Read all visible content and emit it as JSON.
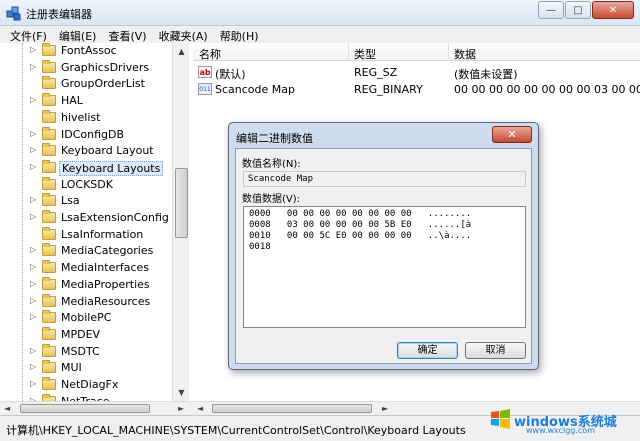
{
  "window": {
    "title": "注册表编辑器",
    "minimize_glyph": "—",
    "maximize_glyph": "□",
    "close_glyph": "✕"
  },
  "menu": [
    "文件(F)",
    "编辑(E)",
    "查看(V)",
    "收藏夹(A)",
    "帮助(H)"
  ],
  "tree": {
    "items": [
      {
        "label": "FontAssoc",
        "expandable": true,
        "selected": false
      },
      {
        "label": "GraphicsDrivers",
        "expandable": true,
        "selected": false
      },
      {
        "label": "GroupOrderList",
        "expandable": false,
        "selected": false
      },
      {
        "label": "HAL",
        "expandable": true,
        "selected": false
      },
      {
        "label": "hivelist",
        "expandable": false,
        "selected": false
      },
      {
        "label": "IDConfigDB",
        "expandable": true,
        "selected": false
      },
      {
        "label": "Keyboard Layout",
        "expandable": true,
        "selected": false
      },
      {
        "label": "Keyboard Layouts",
        "expandable": true,
        "selected": true
      },
      {
        "label": "LOCKSDK",
        "expandable": false,
        "selected": false
      },
      {
        "label": "Lsa",
        "expandable": true,
        "selected": false
      },
      {
        "label": "LsaExtensionConfig",
        "expandable": true,
        "selected": false
      },
      {
        "label": "LsaInformation",
        "expandable": false,
        "selected": false
      },
      {
        "label": "MediaCategories",
        "expandable": true,
        "selected": false
      },
      {
        "label": "MediaInterfaces",
        "expandable": true,
        "selected": false
      },
      {
        "label": "MediaProperties",
        "expandable": true,
        "selected": false
      },
      {
        "label": "MediaResources",
        "expandable": true,
        "selected": false
      },
      {
        "label": "MobilePC",
        "expandable": true,
        "selected": false
      },
      {
        "label": "MPDEV",
        "expandable": false,
        "selected": false
      },
      {
        "label": "MSDTC",
        "expandable": true,
        "selected": false
      },
      {
        "label": "MUI",
        "expandable": true,
        "selected": false
      },
      {
        "label": "NetDiagFx",
        "expandable": true,
        "selected": false
      },
      {
        "label": "NetTrace",
        "expandable": true,
        "selected": false
      }
    ]
  },
  "values_pane": {
    "headers": {
      "name": "名称",
      "type": "类型",
      "data": "数据"
    },
    "rows": [
      {
        "icon": "string-value-icon",
        "icon_glyph": "ab",
        "name": "(默认)",
        "type": "REG_SZ",
        "data": "(数值未设置)"
      },
      {
        "icon": "binary-value-icon",
        "icon_glyph": "011",
        "name": "Scancode Map",
        "type": "REG_BINARY",
        "data": "00 00 00 00 00 00 00 00 03 00 00 00"
      }
    ]
  },
  "statusbar": {
    "path": "计算机\\HKEY_LOCAL_MACHINE\\SYSTEM\\CurrentControlSet\\Control\\Keyboard Layouts"
  },
  "dialog": {
    "title": "编辑二进制数值",
    "close_glyph": "✕",
    "name_label": "数值名称(N):",
    "name_value": "Scancode Map",
    "data_label": "数值数据(V):",
    "hex_lines": [
      "0000   00 00 00 00 00 00 00 00   ........",
      "0008   03 00 00 00 00 00 5B E0   ......[à",
      "0010   00 00 5C E0 00 00 00 00   ..\\à....",
      "0018"
    ],
    "ok_label": "确定",
    "cancel_label": "取消"
  },
  "watermark": {
    "text": "windows系统城",
    "url": "www.wxclgg.com"
  }
}
